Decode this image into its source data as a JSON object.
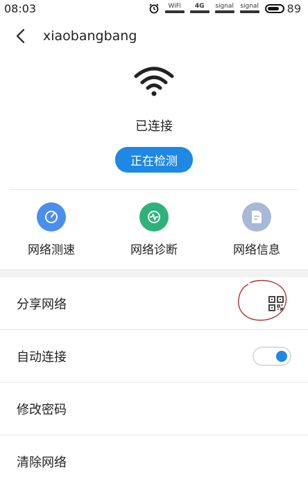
{
  "status_bar": {
    "time": "08:03",
    "wifi_label": "WiFi",
    "network_label": "4G",
    "signal1_label": "signal",
    "signal2_label": "signal",
    "battery": "89"
  },
  "header": {
    "title": "xiaobangbang"
  },
  "hero": {
    "status": "已连接",
    "check_button": "正在检测"
  },
  "tools": [
    {
      "label": "网络测速",
      "icon": "speedometer-icon",
      "color": "#4a8ff0"
    },
    {
      "label": "网络诊断",
      "icon": "pulse-icon",
      "color": "#2db37a"
    },
    {
      "label": "网络信息",
      "icon": "document-icon",
      "color": "#a8b8d8"
    }
  ],
  "list": {
    "share": "分享网络",
    "auto_connect": "自动连接",
    "auto_connect_on": true,
    "change_password": "修改密码",
    "clear_network": "清除网络"
  },
  "colors": {
    "accent": "#1e88e5",
    "annotation": "#b03030"
  }
}
